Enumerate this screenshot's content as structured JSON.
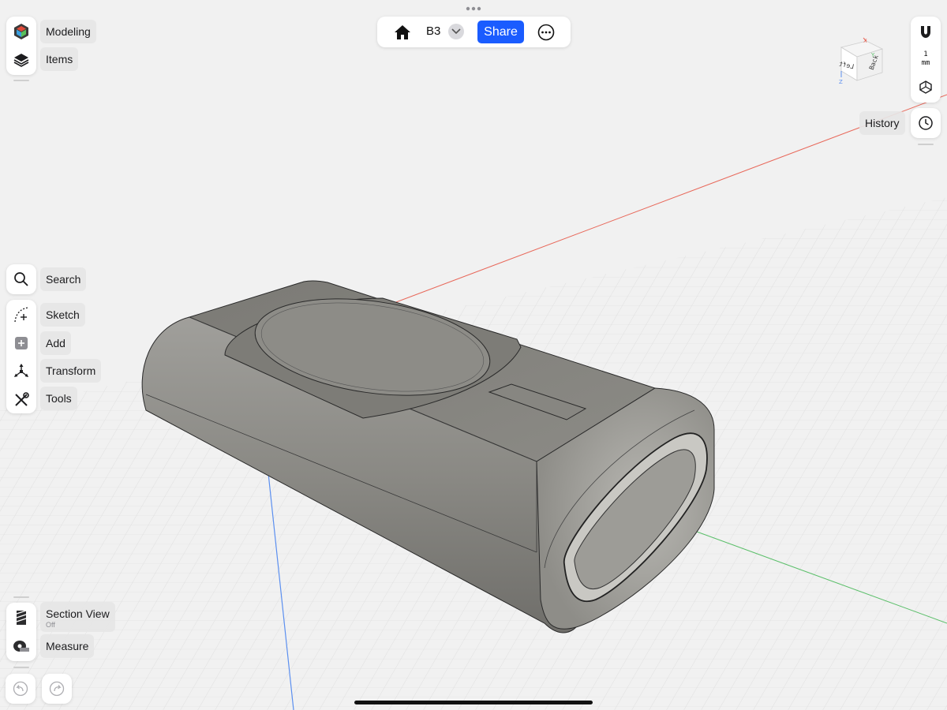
{
  "top_bar": {
    "home_icon": "home-icon",
    "document_name": "B3",
    "dropdown_icon": "chevron-down-icon",
    "share_label": "Share",
    "more_icon": "ellipsis-circle-icon",
    "share_color": "#1a5cff"
  },
  "left_top": {
    "modeling_label": "Modeling",
    "items_label": "Items"
  },
  "left_tools": {
    "search_label": "Search",
    "sketch_label": "Sketch",
    "add_label": "Add",
    "transform_label": "Transform",
    "tools_label": "Tools"
  },
  "left_bottom": {
    "section_view_label": "Section View",
    "section_view_status": "Off",
    "measure_label": "Measure"
  },
  "right": {
    "units_top": "1",
    "units_bottom": "mm",
    "history_label": "History"
  },
  "view_cube": {
    "face_left": "Left",
    "face_back": "Back",
    "axis_x": "X",
    "axis_y": "Y",
    "axis_z": "Z"
  },
  "colors": {
    "axis_x": "#e8685a",
    "axis_y": "#5bbf6a",
    "axis_z": "#5b8ff0",
    "model_body": "#8a8984"
  }
}
